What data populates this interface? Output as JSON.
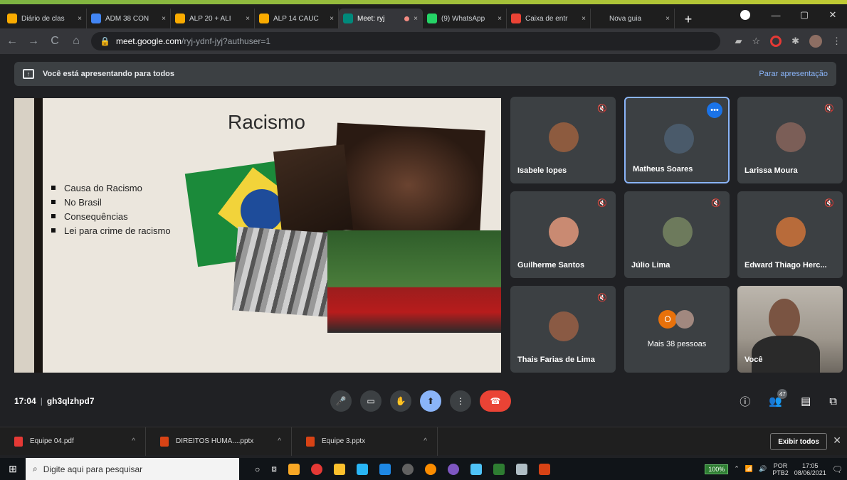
{
  "browser": {
    "tabs": [
      {
        "title": "Diário de clas",
        "color": "#f9ab00",
        "active": false
      },
      {
        "title": "ADM 38 CON",
        "color": "#4285f4",
        "active": false
      },
      {
        "title": "ALP 20 + ALI",
        "color": "#f9ab00",
        "active": false
      },
      {
        "title": "ALP 14 CAUC",
        "color": "#f9ab00",
        "active": false
      },
      {
        "title": "Meet: ryj",
        "color": "#00897b",
        "active": true
      },
      {
        "title": "(9) WhatsApp",
        "color": "#25d366",
        "active": false
      },
      {
        "title": "Caixa de entr",
        "color": "#ea4335",
        "active": false
      },
      {
        "title": "Nova guia",
        "color": "#1e1e1e",
        "active": false
      }
    ],
    "tab_close": "×",
    "new_tab": "+",
    "url_host": "meet.google.com",
    "url_path": "/ryj-ydnf-jyj?authuser=1",
    "window_controls": [
      "—",
      "▢",
      "✕"
    ]
  },
  "banner": {
    "text": "Você está apresentando para todos",
    "stop": "Parar apresentação"
  },
  "slide": {
    "title": "Racismo",
    "bullets": [
      "Causa do Racismo",
      "No Brasil",
      "Consequências",
      "Lei para crime de racismo"
    ]
  },
  "participants": [
    {
      "name": "Isabele lopes",
      "muted": true,
      "avatar_color": "#8d5b3f"
    },
    {
      "name": "Matheus Soares",
      "muted": false,
      "avatar_color": "#4a5a6a",
      "selected": true
    },
    {
      "name": "Larissa Moura",
      "muted": true,
      "avatar_color": "#7b5e57"
    },
    {
      "name": "Guilherme Santos",
      "muted": true,
      "avatar_color": "#c98a72"
    },
    {
      "name": "Júlio Lima",
      "muted": true,
      "avatar_color": "#6d7a5c"
    },
    {
      "name": "Edward Thiago Herc...",
      "muted": true,
      "avatar_color": "#b86b3a"
    },
    {
      "name": "Thais Farias de Lima",
      "muted": true,
      "avatar_color": "#8a5a44"
    }
  ],
  "more_people": {
    "count_label": "O",
    "text": "Mais 38 pessoas"
  },
  "self_tile": {
    "name": "Você"
  },
  "meeting": {
    "time": "17:04",
    "code": "gh3qlzhpd7",
    "participants_count": "47"
  },
  "icons": {
    "mic": "mic-icon",
    "camera": "camera-icon",
    "hand": "raise-hand-icon",
    "present": "present-icon",
    "more": "more-icon",
    "end": "end-call-icon"
  },
  "downloads": {
    "items": [
      {
        "name": "Equipe 04.pdf",
        "color": "#e53935"
      },
      {
        "name": "DIREITOS HUMA....pptx",
        "color": "#d84315"
      },
      {
        "name": "Equipe 3.pptx",
        "color": "#d84315"
      }
    ],
    "show_all": "Exibir todos",
    "close": "✕"
  },
  "taskbar": {
    "search_placeholder": "Digite aqui para pesquisar",
    "battery": "100%",
    "lang1": "POR",
    "lang2": "PTB2",
    "time": "17:05",
    "date": "08/06/2021"
  }
}
